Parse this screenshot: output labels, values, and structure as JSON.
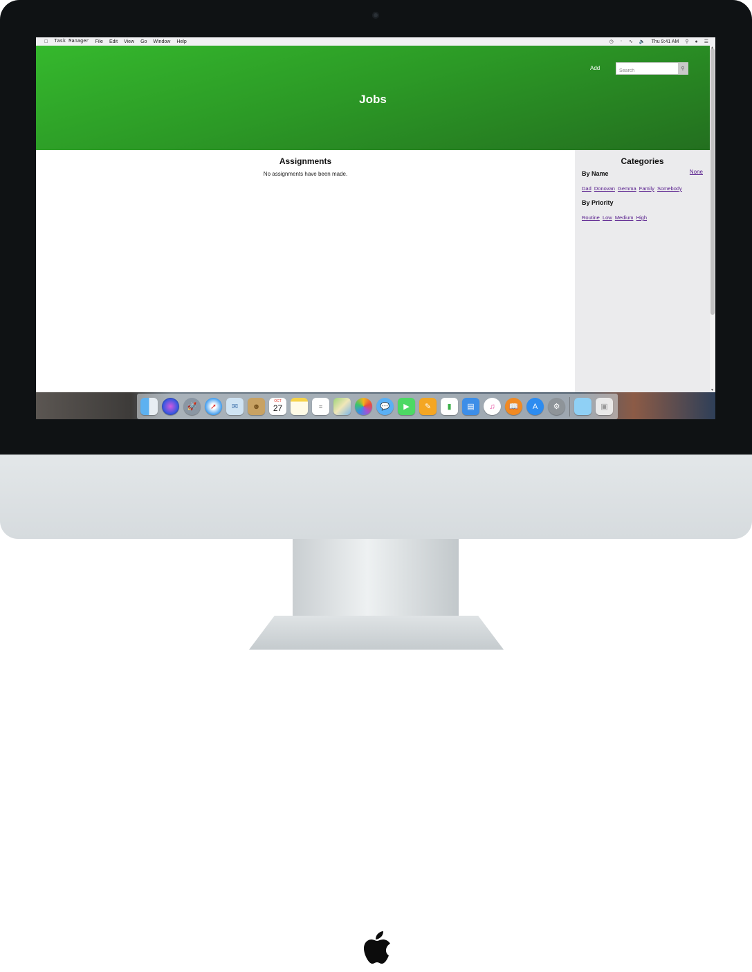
{
  "menubar": {
    "app_name": "Task Manager",
    "items": [
      "File",
      "Edit",
      "View",
      "Go",
      "Window",
      "Help"
    ],
    "clock": "Thu 9:41 AM"
  },
  "header": {
    "title": "Jobs",
    "add_label": "Add",
    "search_placeholder": "Search",
    "color_start": "#35b82d",
    "color_end": "#236f1f"
  },
  "main": {
    "heading": "Assignments",
    "empty_message": "No assignments have been made."
  },
  "sidebar": {
    "heading": "Categories",
    "none_label": "None",
    "by_name_heading": "By Name",
    "names": [
      "Dad",
      "Donovan",
      "Gemma",
      "Family",
      "Somebody"
    ],
    "by_priority_heading": "By Priority",
    "priorities": [
      "Routine",
      "Low",
      "Medium",
      "High"
    ]
  },
  "dock": {
    "calendar_month": "OCT",
    "calendar_day": "27",
    "icons": [
      "finder-icon",
      "siri-icon",
      "launchpad-icon",
      "safari-icon",
      "mail-icon",
      "contacts-icon",
      "calendar-icon",
      "notes-icon",
      "reminders-icon",
      "maps-icon",
      "photos-icon",
      "messages-icon",
      "facetime-icon",
      "pages-icon",
      "numbers-icon",
      "keynote-icon",
      "itunes-icon",
      "ibooks-icon",
      "app-store-icon",
      "system-preferences-icon",
      "downloads-folder-icon",
      "trash-icon"
    ]
  },
  "colors": {
    "link": "#551a8b",
    "sidebar_bg": "#ebebed"
  }
}
